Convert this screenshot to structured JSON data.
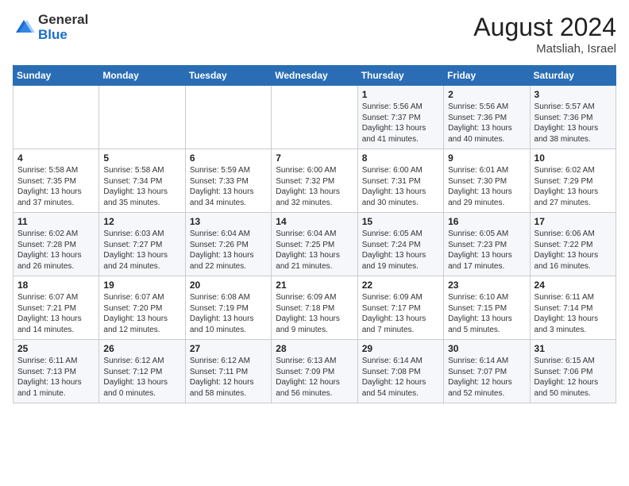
{
  "header": {
    "logo_general": "General",
    "logo_blue": "Blue",
    "month_year": "August 2024",
    "location": "Matsliah, Israel"
  },
  "days_of_week": [
    "Sunday",
    "Monday",
    "Tuesday",
    "Wednesday",
    "Thursday",
    "Friday",
    "Saturday"
  ],
  "weeks": [
    [
      {
        "day": "",
        "info": ""
      },
      {
        "day": "",
        "info": ""
      },
      {
        "day": "",
        "info": ""
      },
      {
        "day": "",
        "info": ""
      },
      {
        "day": "1",
        "info": "Sunrise: 5:56 AM\nSunset: 7:37 PM\nDaylight: 13 hours\nand 41 minutes."
      },
      {
        "day": "2",
        "info": "Sunrise: 5:56 AM\nSunset: 7:36 PM\nDaylight: 13 hours\nand 40 minutes."
      },
      {
        "day": "3",
        "info": "Sunrise: 5:57 AM\nSunset: 7:36 PM\nDaylight: 13 hours\nand 38 minutes."
      }
    ],
    [
      {
        "day": "4",
        "info": "Sunrise: 5:58 AM\nSunset: 7:35 PM\nDaylight: 13 hours\nand 37 minutes."
      },
      {
        "day": "5",
        "info": "Sunrise: 5:58 AM\nSunset: 7:34 PM\nDaylight: 13 hours\nand 35 minutes."
      },
      {
        "day": "6",
        "info": "Sunrise: 5:59 AM\nSunset: 7:33 PM\nDaylight: 13 hours\nand 34 minutes."
      },
      {
        "day": "7",
        "info": "Sunrise: 6:00 AM\nSunset: 7:32 PM\nDaylight: 13 hours\nand 32 minutes."
      },
      {
        "day": "8",
        "info": "Sunrise: 6:00 AM\nSunset: 7:31 PM\nDaylight: 13 hours\nand 30 minutes."
      },
      {
        "day": "9",
        "info": "Sunrise: 6:01 AM\nSunset: 7:30 PM\nDaylight: 13 hours\nand 29 minutes."
      },
      {
        "day": "10",
        "info": "Sunrise: 6:02 AM\nSunset: 7:29 PM\nDaylight: 13 hours\nand 27 minutes."
      }
    ],
    [
      {
        "day": "11",
        "info": "Sunrise: 6:02 AM\nSunset: 7:28 PM\nDaylight: 13 hours\nand 26 minutes."
      },
      {
        "day": "12",
        "info": "Sunrise: 6:03 AM\nSunset: 7:27 PM\nDaylight: 13 hours\nand 24 minutes."
      },
      {
        "day": "13",
        "info": "Sunrise: 6:04 AM\nSunset: 7:26 PM\nDaylight: 13 hours\nand 22 minutes."
      },
      {
        "day": "14",
        "info": "Sunrise: 6:04 AM\nSunset: 7:25 PM\nDaylight: 13 hours\nand 21 minutes."
      },
      {
        "day": "15",
        "info": "Sunrise: 6:05 AM\nSunset: 7:24 PM\nDaylight: 13 hours\nand 19 minutes."
      },
      {
        "day": "16",
        "info": "Sunrise: 6:05 AM\nSunset: 7:23 PM\nDaylight: 13 hours\nand 17 minutes."
      },
      {
        "day": "17",
        "info": "Sunrise: 6:06 AM\nSunset: 7:22 PM\nDaylight: 13 hours\nand 16 minutes."
      }
    ],
    [
      {
        "day": "18",
        "info": "Sunrise: 6:07 AM\nSunset: 7:21 PM\nDaylight: 13 hours\nand 14 minutes."
      },
      {
        "day": "19",
        "info": "Sunrise: 6:07 AM\nSunset: 7:20 PM\nDaylight: 13 hours\nand 12 minutes."
      },
      {
        "day": "20",
        "info": "Sunrise: 6:08 AM\nSunset: 7:19 PM\nDaylight: 13 hours\nand 10 minutes."
      },
      {
        "day": "21",
        "info": "Sunrise: 6:09 AM\nSunset: 7:18 PM\nDaylight: 13 hours\nand 9 minutes."
      },
      {
        "day": "22",
        "info": "Sunrise: 6:09 AM\nSunset: 7:17 PM\nDaylight: 13 hours\nand 7 minutes."
      },
      {
        "day": "23",
        "info": "Sunrise: 6:10 AM\nSunset: 7:15 PM\nDaylight: 13 hours\nand 5 minutes."
      },
      {
        "day": "24",
        "info": "Sunrise: 6:11 AM\nSunset: 7:14 PM\nDaylight: 13 hours\nand 3 minutes."
      }
    ],
    [
      {
        "day": "25",
        "info": "Sunrise: 6:11 AM\nSunset: 7:13 PM\nDaylight: 13 hours\nand 1 minute."
      },
      {
        "day": "26",
        "info": "Sunrise: 6:12 AM\nSunset: 7:12 PM\nDaylight: 13 hours\nand 0 minutes."
      },
      {
        "day": "27",
        "info": "Sunrise: 6:12 AM\nSunset: 7:11 PM\nDaylight: 12 hours\nand 58 minutes."
      },
      {
        "day": "28",
        "info": "Sunrise: 6:13 AM\nSunset: 7:09 PM\nDaylight: 12 hours\nand 56 minutes."
      },
      {
        "day": "29",
        "info": "Sunrise: 6:14 AM\nSunset: 7:08 PM\nDaylight: 12 hours\nand 54 minutes."
      },
      {
        "day": "30",
        "info": "Sunrise: 6:14 AM\nSunset: 7:07 PM\nDaylight: 12 hours\nand 52 minutes."
      },
      {
        "day": "31",
        "info": "Sunrise: 6:15 AM\nSunset: 7:06 PM\nDaylight: 12 hours\nand 50 minutes."
      }
    ]
  ]
}
